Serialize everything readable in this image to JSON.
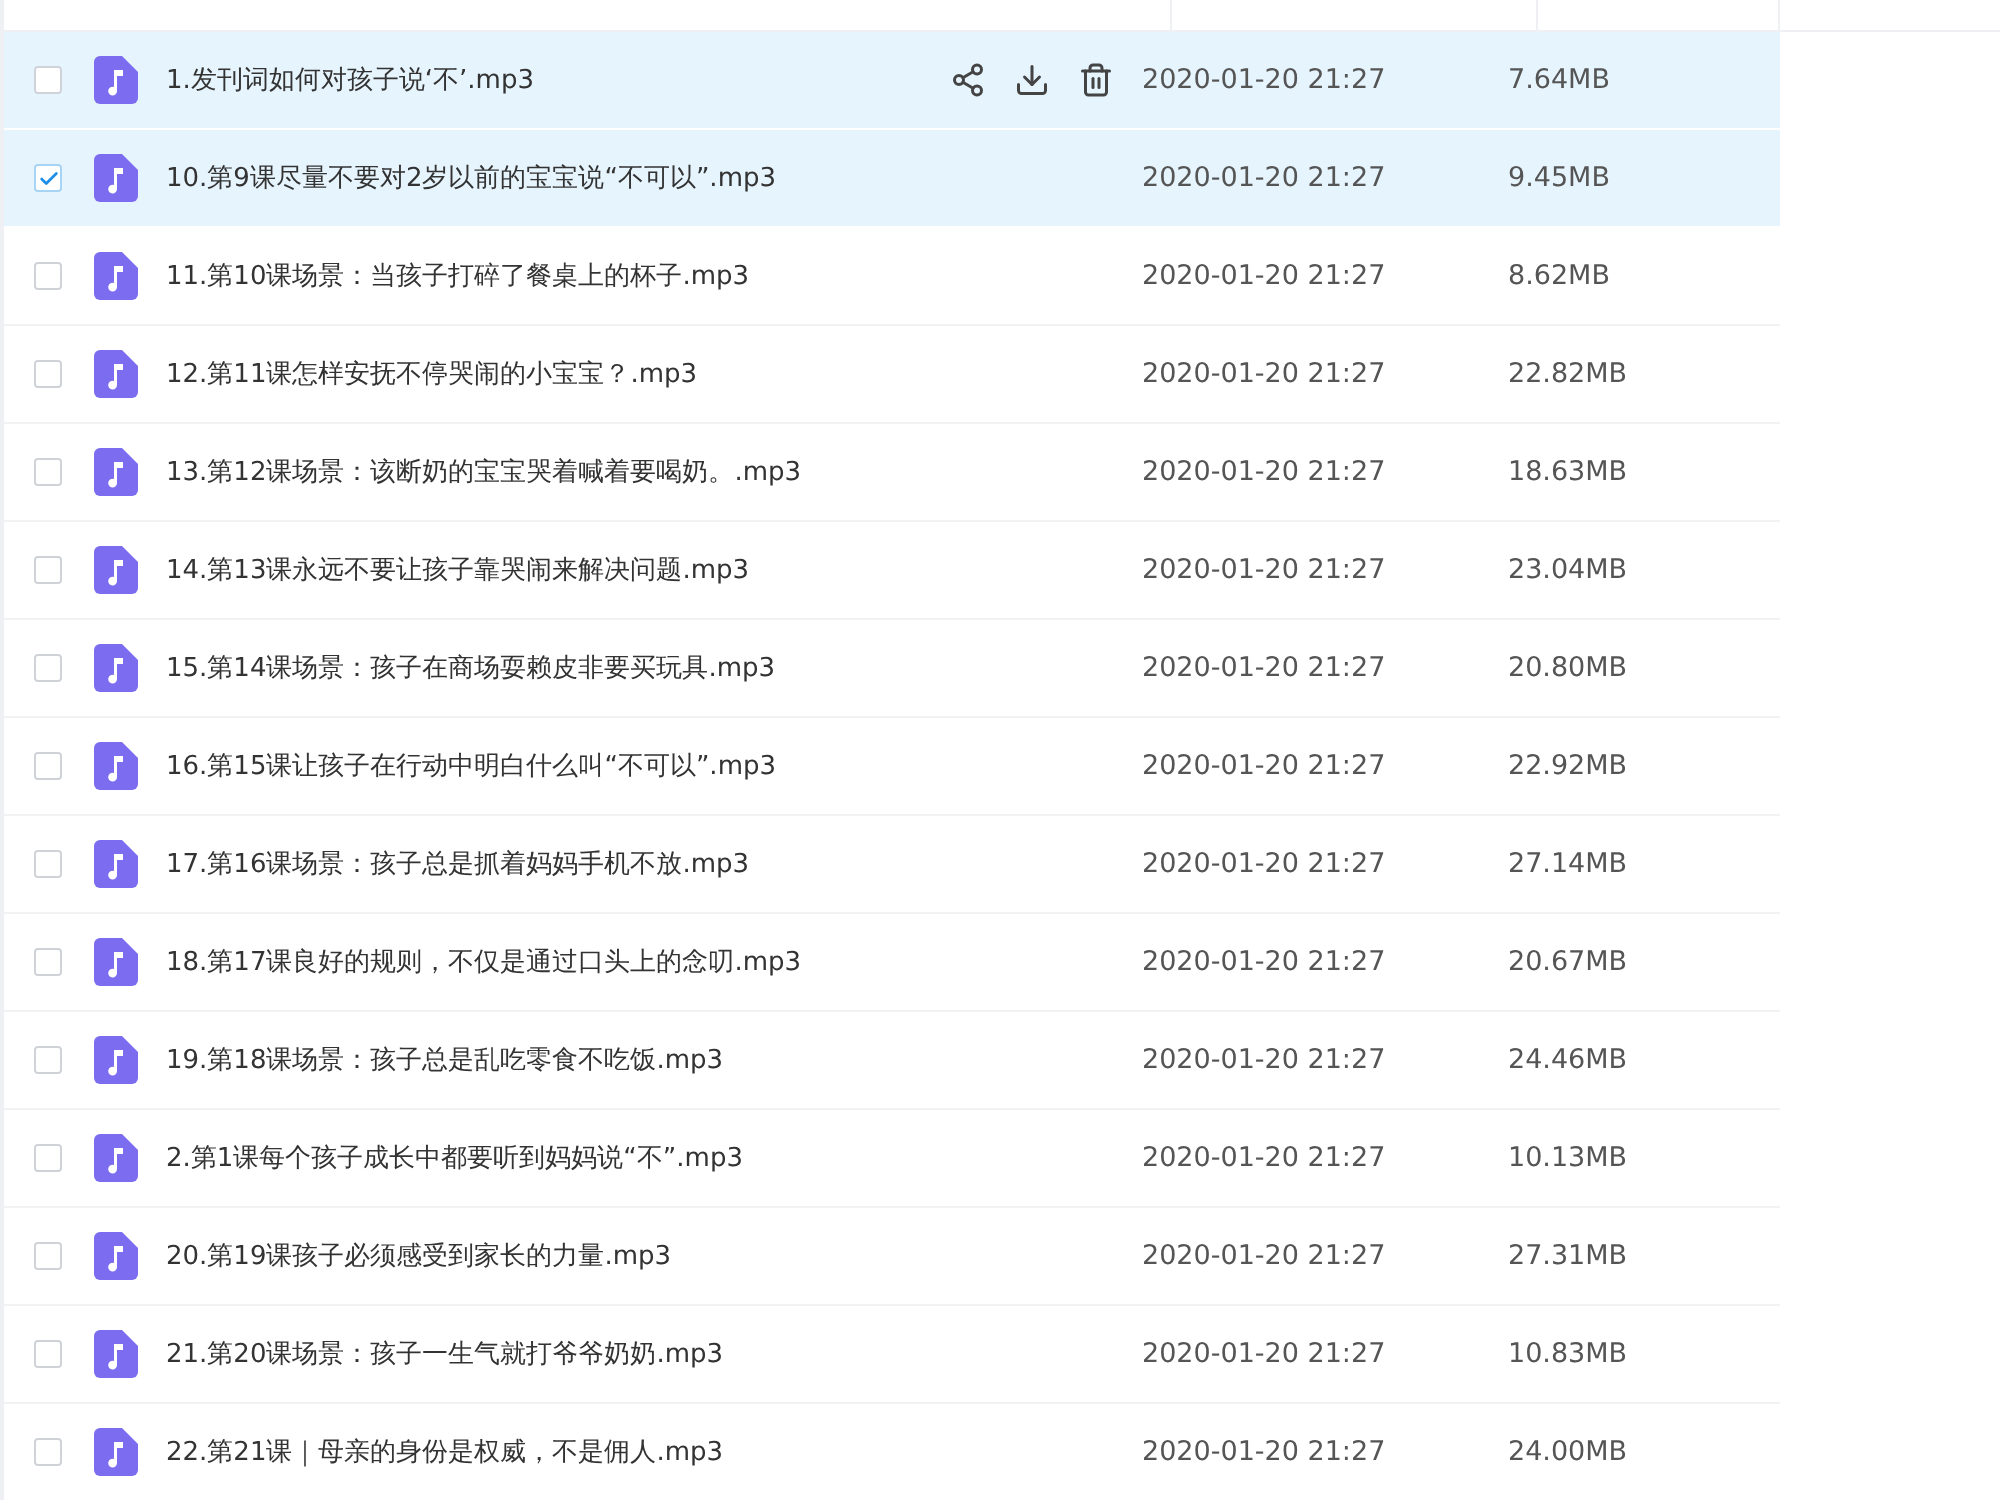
{
  "files": [
    {
      "name": "1.发刊词如何对孩子说‘不’.mp3",
      "modified": "2020-01-20 21:27",
      "size": "7.64MB",
      "checked": false,
      "hovered": true
    },
    {
      "name": "10.第9课尽量不要对2岁以前的宝宝说“不可以”.mp3",
      "modified": "2020-01-20 21:27",
      "size": "9.45MB",
      "checked": true,
      "hovered": false
    },
    {
      "name": "11.第10课场景：当孩子打碎了餐桌上的杯子.mp3",
      "modified": "2020-01-20 21:27",
      "size": "8.62MB",
      "checked": false,
      "hovered": false
    },
    {
      "name": "12.第11课怎样安抚不停哭闹的小宝宝？.mp3",
      "modified": "2020-01-20 21:27",
      "size": "22.82MB",
      "checked": false,
      "hovered": false
    },
    {
      "name": "13.第12课场景：该断奶的宝宝哭着喊着要喝奶。.mp3",
      "modified": "2020-01-20 21:27",
      "size": "18.63MB",
      "checked": false,
      "hovered": false
    },
    {
      "name": "14.第13课永远不要让孩子靠哭闹来解决问题.mp3",
      "modified": "2020-01-20 21:27",
      "size": "23.04MB",
      "checked": false,
      "hovered": false
    },
    {
      "name": "15.第14课场景：孩子在商场耍赖皮非要买玩具.mp3",
      "modified": "2020-01-20 21:27",
      "size": "20.80MB",
      "checked": false,
      "hovered": false
    },
    {
      "name": "16.第15课让孩子在行动中明白什么叫“不可以”.mp3",
      "modified": "2020-01-20 21:27",
      "size": "22.92MB",
      "checked": false,
      "hovered": false
    },
    {
      "name": "17.第16课场景：孩子总是抓着妈妈手机不放.mp3",
      "modified": "2020-01-20 21:27",
      "size": "27.14MB",
      "checked": false,
      "hovered": false
    },
    {
      "name": "18.第17课良好的规则，不仅是通过口头上的念叨.mp3",
      "modified": "2020-01-20 21:27",
      "size": "20.67MB",
      "checked": false,
      "hovered": false
    },
    {
      "name": "19.第18课场景：孩子总是乱吃零食不吃饭.mp3",
      "modified": "2020-01-20 21:27",
      "size": "24.46MB",
      "checked": false,
      "hovered": false
    },
    {
      "name": "2.第1课每个孩子成长中都要听到妈妈说“不”.mp3",
      "modified": "2020-01-20 21:27",
      "size": "10.13MB",
      "checked": false,
      "hovered": false
    },
    {
      "name": "20.第19课孩子必须感受到家长的力量.mp3",
      "modified": "2020-01-20 21:27",
      "size": "27.31MB",
      "checked": false,
      "hovered": false
    },
    {
      "name": "21.第20课场景：孩子一生气就打爷爷奶奶.mp3",
      "modified": "2020-01-20 21:27",
      "size": "10.83MB",
      "checked": false,
      "hovered": false
    },
    {
      "name": "22.第21课｜母亲的身份是权威，不是佣人.mp3",
      "modified": "2020-01-20 21:27",
      "size": "24.00MB",
      "checked": false,
      "hovered": false
    }
  ]
}
